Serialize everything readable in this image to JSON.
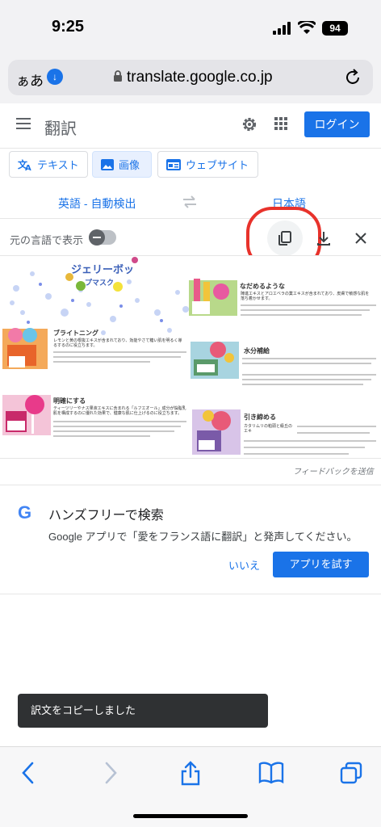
{
  "status_bar": {
    "time": "9:25",
    "battery": "94"
  },
  "browser": {
    "text_size_label": "ぁあ",
    "url": "translate.google.co.jp"
  },
  "header": {
    "title": "翻訳",
    "login_label": "ログイン"
  },
  "tabs": [
    {
      "label": "テキスト",
      "active": false
    },
    {
      "label": "画像",
      "active": true
    },
    {
      "label": "ウェブサイト",
      "active": false
    }
  ],
  "languages": {
    "source": "英語 - 自動検出",
    "target": "日本語"
  },
  "toolbar": {
    "show_original_label": "元の言語で表示",
    "show_original_on": false
  },
  "translated_image": {
    "title_line1": "ジェリーボッ",
    "title_line2": "プマスク",
    "headings": [
      "なだめるような",
      "ブライトニング",
      "水分補給",
      "明確にする",
      "引き締める"
    ],
    "snippet1": "レモンと黄の根抜エキスが含まれており、効能やさて糖い肌を明るく導るするのに役立ちます。",
    "snippet2": "ティーツリーやナス果液エキスに含まれる「ルフエオール」成分が悩脂乳肌を構成するのに優れた効果で、健康な肌に仕上げるのに役立ちます。",
    "snippet3": "カタリムリの粕頭と級丘のエキ",
    "snippet4": "陣進エキスとアロエベラの業エキスが含まれており、皮膚で敏感な肌を落ち着かせます。"
  },
  "feedback_label": "フィードバックを送信",
  "promo_card": {
    "logo": "G",
    "title": "ハンズフリーで検索",
    "body": "Google アプリで「愛をフランス語に翻訳」と発声してください。",
    "dismiss_label": "いいえ",
    "action_label": "アプリを試す"
  },
  "toast": {
    "message": "訳文をコピーしました"
  },
  "colors": {
    "accent": "#1a73e8",
    "highlight": "#e8322b",
    "toast_bg": "#2f3133"
  }
}
